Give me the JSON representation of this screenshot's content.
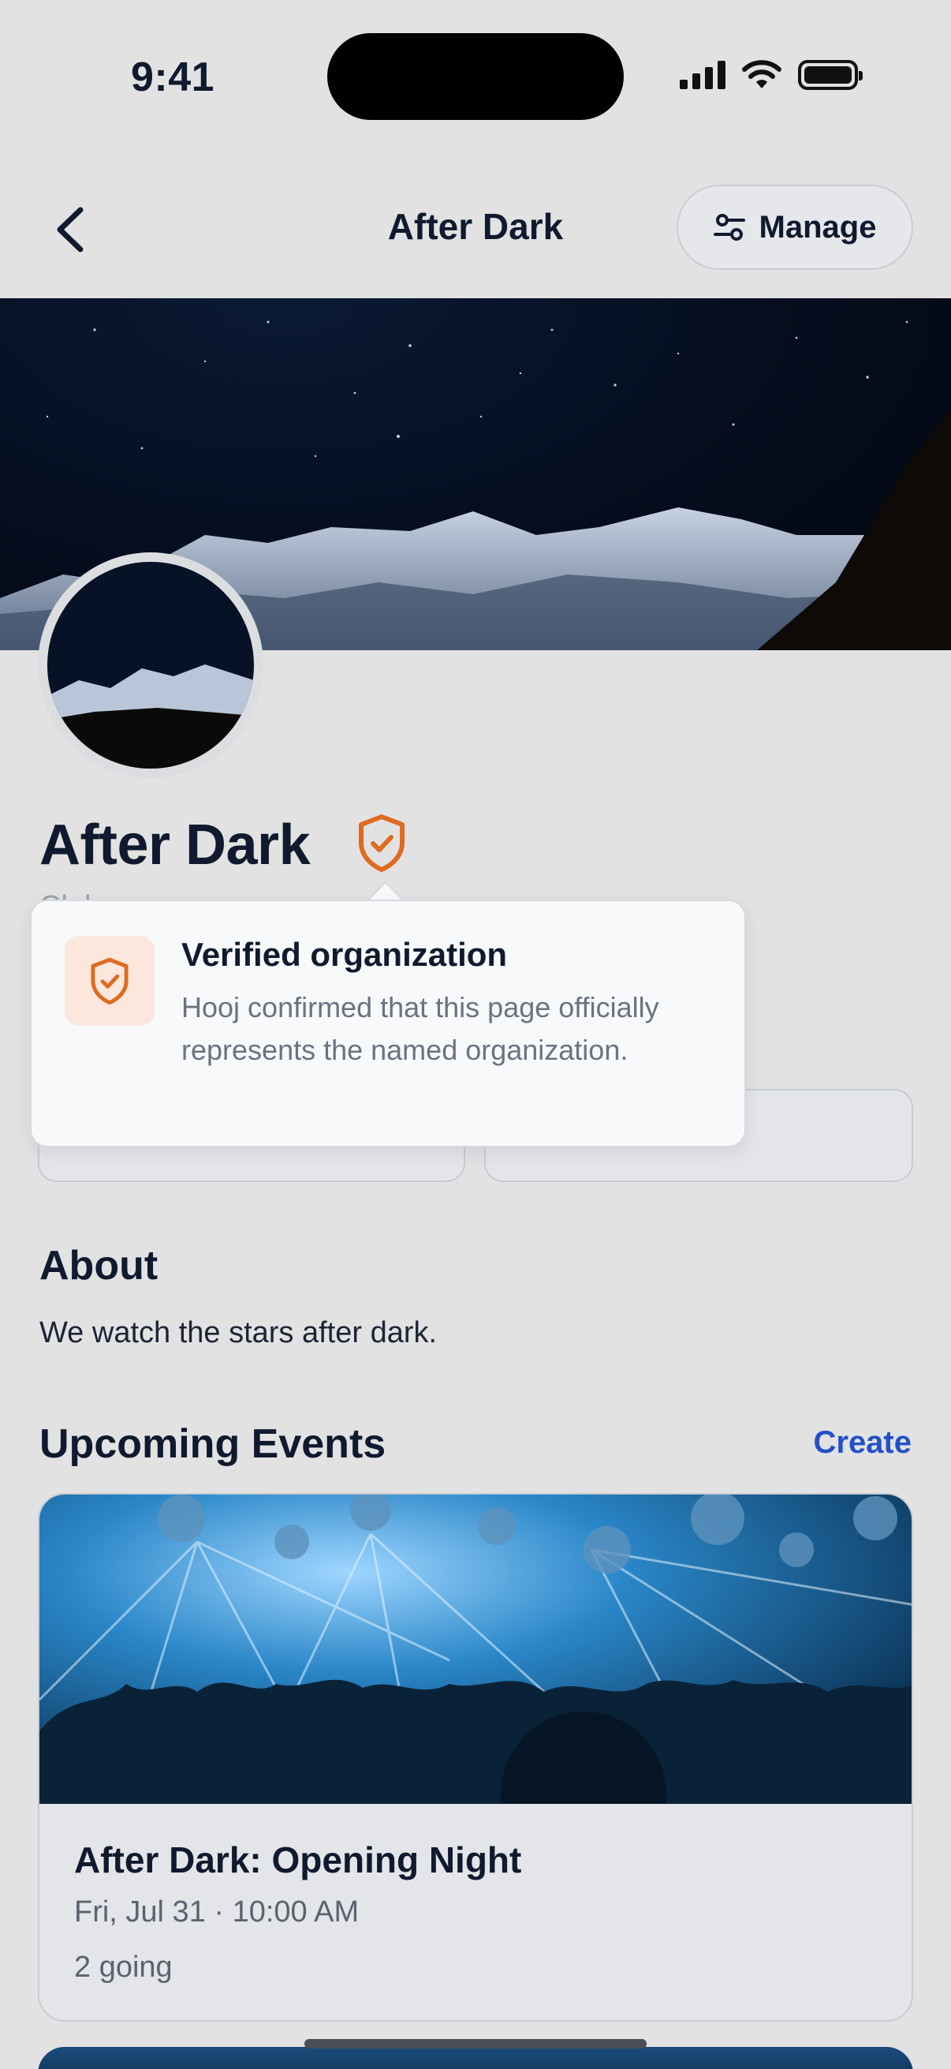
{
  "status_bar": {
    "time": "9:41"
  },
  "nav": {
    "title": "After Dark",
    "manage_label": "Manage"
  },
  "profile": {
    "name": "After Dark",
    "subtitle_peek": "Club"
  },
  "tooltip": {
    "title": "Verified organization",
    "body": "Hooj confirmed that this page officially represents the named organization."
  },
  "about": {
    "heading": "About",
    "text": "We watch the stars after dark."
  },
  "events": {
    "heading": "Upcoming Events",
    "create_label": "Create",
    "items": [
      {
        "title": "After Dark: Opening Night",
        "date": "Fri, Jul 31 · 10:00 AM",
        "going": "2 going"
      }
    ]
  },
  "colors": {
    "background": "#e2e2e3",
    "text": "#101a2e",
    "accent_link": "#2251c7",
    "verified_orange": "#e06a1f"
  },
  "icons": [
    "back-chevron-icon",
    "sliders-icon",
    "verified-shield-icon",
    "signal-icon",
    "wifi-icon",
    "battery-icon"
  ]
}
